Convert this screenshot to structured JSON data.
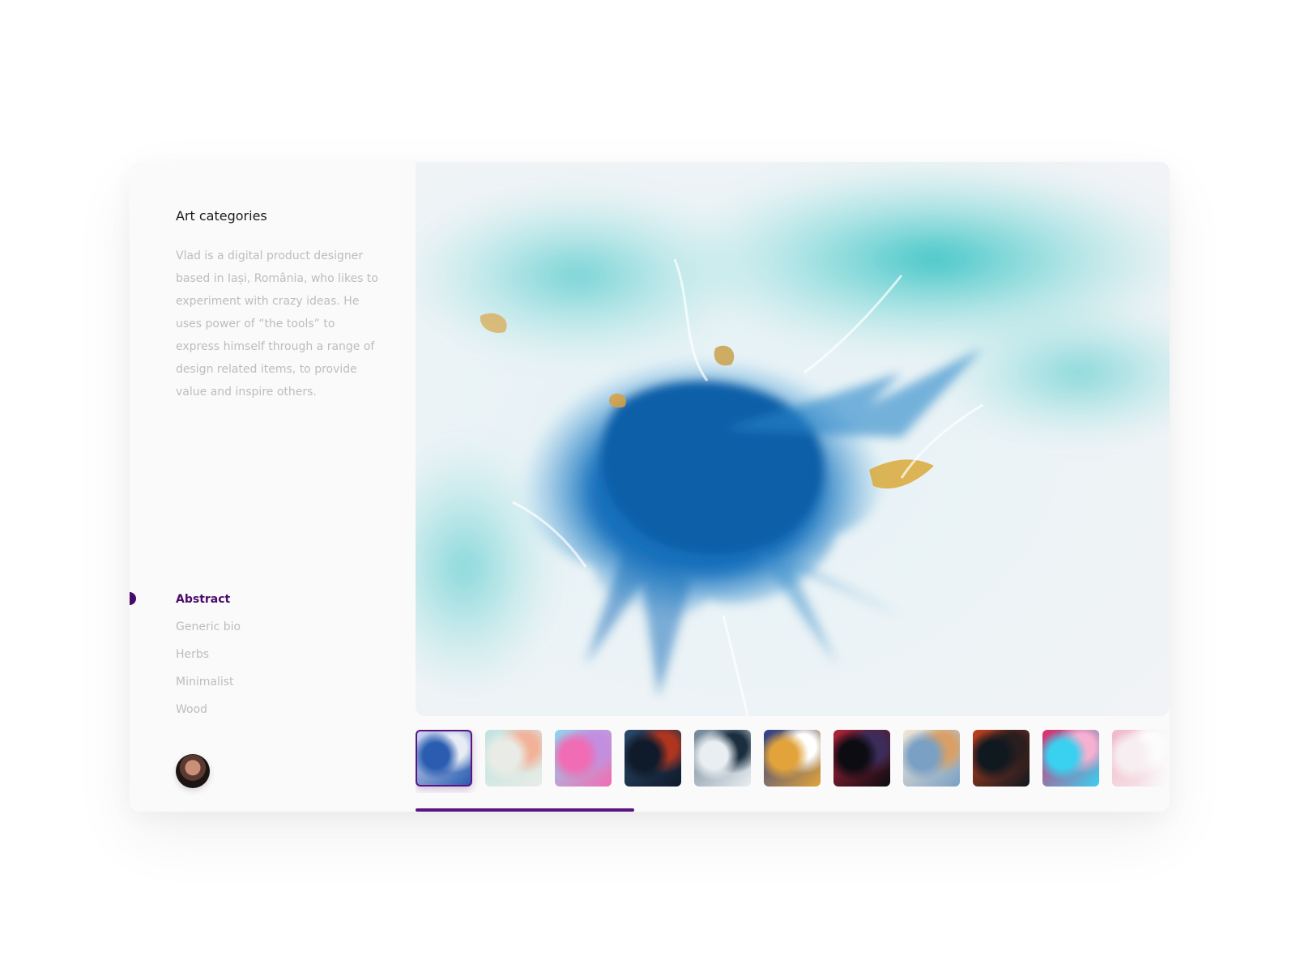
{
  "sidebar": {
    "title": "Art categories",
    "bio": "Vlad is a digital product designer based in Iași, România, who likes to experiment with crazy ideas. He uses power of “the tools” to express himself through a range of design related items, to provide value and inspire others.",
    "categories": [
      {
        "label": "Abstract",
        "active": true
      },
      {
        "label": "Generic bio",
        "active": false
      },
      {
        "label": "Herbs",
        "active": false
      },
      {
        "label": "Minimalist",
        "active": false
      },
      {
        "label": "Wood",
        "active": false
      }
    ]
  },
  "gallery": {
    "thumbnails": [
      {
        "name": "blue-splash",
        "colors": [
          "#2a5db0",
          "#cfd8ef",
          "#e8ecf5"
        ],
        "selected": true
      },
      {
        "name": "pastel-spots",
        "colors": [
          "#e9ece6",
          "#bfe3e0",
          "#f2b29a"
        ],
        "selected": false
      },
      {
        "name": "pink-swirl",
        "colors": [
          "#f06cb4",
          "#8fd3f0",
          "#c28fe0"
        ],
        "selected": false
      },
      {
        "name": "dark-red",
        "colors": [
          "#0f1a2a",
          "#2b4a6b",
          "#b0351f"
        ],
        "selected": false
      },
      {
        "name": "misty-blue",
        "colors": [
          "#e9eef2",
          "#6e8395",
          "#1a2e3f"
        ],
        "selected": false
      },
      {
        "name": "fire-marble",
        "colors": [
          "#e2a33b",
          "#2a3e8a",
          "#ffffff"
        ],
        "selected": false
      },
      {
        "name": "red-lines",
        "colors": [
          "#0c0c12",
          "#b0243a",
          "#3c2c5a"
        ],
        "selected": false
      },
      {
        "name": "sky-cloud",
        "colors": [
          "#7aa0c4",
          "#f2e6d6",
          "#d8a066"
        ],
        "selected": false
      },
      {
        "name": "lava",
        "colors": [
          "#101820",
          "#c0401e",
          "#2a1e1e"
        ],
        "selected": false
      },
      {
        "name": "neon-gradient",
        "colors": [
          "#3ad0f0",
          "#e02a6a",
          "#f6b0d0"
        ],
        "selected": false
      },
      {
        "name": "blush",
        "colors": [
          "#f7eef1",
          "#f0b8c8",
          "#ffffff"
        ],
        "selected": false
      }
    ],
    "progress": 0.29
  },
  "colors": {
    "accent": "#5b1380",
    "muted_text": "#bdbdbd"
  }
}
